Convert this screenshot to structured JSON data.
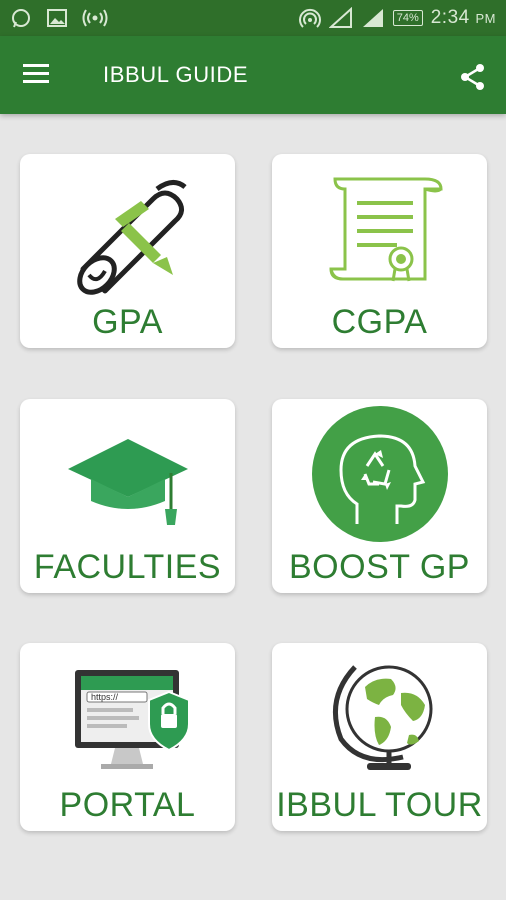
{
  "status_bar": {
    "time": "2:34",
    "time_suffix": "PM",
    "battery": "74%"
  },
  "toolbar": {
    "title": "IBBUL GUIDE",
    "menu_icon": "hamburger-menu-icon",
    "share_icon": "share-icon"
  },
  "colors": {
    "primary": "#2e7d32",
    "status_bar": "#2f6f2a",
    "background": "#e6e6e6",
    "card": "#ffffff",
    "accent": "#8bc34a"
  },
  "cards": [
    {
      "label": "GPA",
      "icon": "diploma-scroll-icon"
    },
    {
      "label": "CGPA",
      "icon": "certificate-icon"
    },
    {
      "label": "FACULTIES",
      "icon": "graduation-cap-icon"
    },
    {
      "label": "BOOST GP",
      "icon": "brain-recycle-icon"
    },
    {
      "label": "PORTAL",
      "icon": "secure-portal-icon",
      "url_text": "https://"
    },
    {
      "label": "IBBUL TOUR",
      "icon": "globe-icon"
    }
  ]
}
